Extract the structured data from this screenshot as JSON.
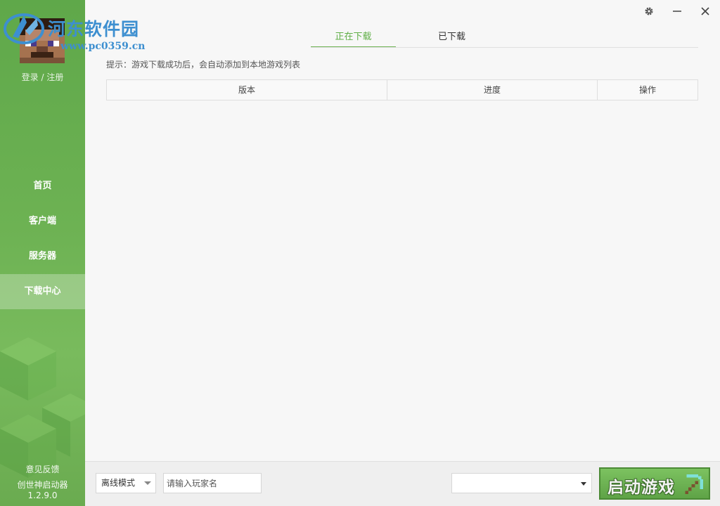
{
  "watermark": {
    "site_name": "河东软件园",
    "url": "www.pc0359.cn"
  },
  "sidebar": {
    "login_label": "登录 / 注册",
    "nav": [
      {
        "label": "首页",
        "active": false
      },
      {
        "label": "客户端",
        "active": false
      },
      {
        "label": "服务器",
        "active": false
      },
      {
        "label": "下载中心",
        "active": true
      }
    ],
    "feedback_label": "意见反馈",
    "app_name": "创世神启动器",
    "version": "1.2.9.0"
  },
  "window_controls": {
    "settings_icon": "gear-icon",
    "minimize_icon": "minimize-icon",
    "close_icon": "close-icon"
  },
  "tabs": [
    {
      "label": "正在下载",
      "active": true
    },
    {
      "label": "已下载",
      "active": false
    }
  ],
  "hint": "提示：游戏下载成功后，会自动添加到本地游戏列表",
  "table": {
    "columns": [
      "版本",
      "进度",
      "操作"
    ],
    "rows": []
  },
  "bottom": {
    "mode_value": "离线模式",
    "player_name_placeholder": "请输入玩家名",
    "player_name_value": "",
    "version_value": "",
    "launch_label": "启动游戏",
    "launch_icon": "pickaxe-icon"
  },
  "colors": {
    "accent": "#6db253",
    "tab_active": "#5fae46",
    "watermark": "#3d8fd0"
  }
}
